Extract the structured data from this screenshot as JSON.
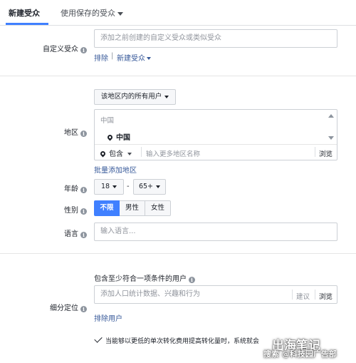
{
  "tabs": {
    "new_audience": "新建受众",
    "saved_audience": "使用保存的受众"
  },
  "custom_audience": {
    "label": "自定义受众",
    "placeholder": "添加之前创建的自定义受众或类似受众",
    "exclude_link": "排除",
    "separator": "|",
    "create_link": "新建受众"
  },
  "location": {
    "scope_dropdown": "该地区内的所有用户",
    "label": "地区",
    "region_header": "中国",
    "selected_item": "中国",
    "include_dropdown": "包含",
    "search_placeholder": "输入更多地区名称",
    "browse": "浏览",
    "bulk_add_link": "批量添加地区"
  },
  "age": {
    "label": "年龄",
    "min": "18",
    "dash": "-",
    "max": "65+"
  },
  "gender": {
    "label": "性别",
    "options": [
      "不限",
      "男性",
      "女性"
    ],
    "selected": "不限"
  },
  "language": {
    "label": "语言",
    "placeholder": "输入语言..."
  },
  "detailed_targeting": {
    "header": "包含至少符合一项条件的用户",
    "label": "细分定位",
    "placeholder": "添加人口统计数据、兴趣和行为",
    "suggestions": "建议",
    "browse": "浏览",
    "exclude_link": "排除用户",
    "expansion_text": "当能够以更低的单次转化费用提高转化量时，系统就会"
  },
  "watermark": {
    "line1": "出海笔记",
    "line2": "搜索 @科技园广告部"
  },
  "colors": {
    "accent": "#4080ff",
    "link": "#365899",
    "border": "#ccd0d5"
  }
}
